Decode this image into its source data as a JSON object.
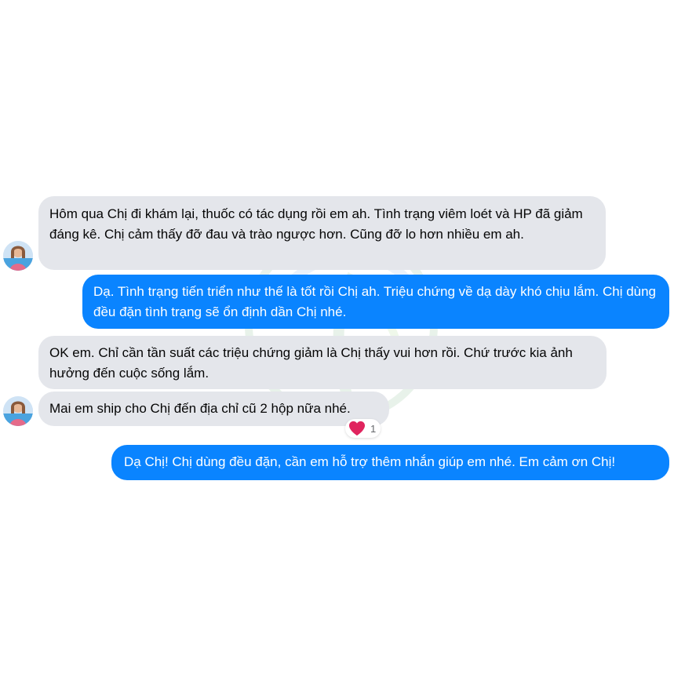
{
  "messages": [
    {
      "id": "m1",
      "direction": "incoming",
      "text": "Hôm qua Chị đi khám lại, thuốc có tác dụng rồi em ah. Tình trạng viêm loét và HP đã giảm đáng kê. Chị cảm thấy đỡ đau và trào ngược hơn. Cũng đỡ lo hơn nhiều em ah."
    },
    {
      "id": "m2",
      "direction": "outgoing",
      "text": "Dạ. Tình trạng tiến triển như thế là tốt rồi Chị ah. Triệu chứng về dạ dày khó chịu lắm. Chị dùng đều đặn tình trạng sẽ ổn định dần Chị nhé."
    },
    {
      "id": "m3",
      "direction": "incoming",
      "text": "OK em. Chỉ cần tần suất các triệu chứng giảm là Chị thấy vui hơn rồi. Chứ trước kia ảnh hưởng đến cuộc sống lắm."
    },
    {
      "id": "m4",
      "direction": "incoming",
      "text": "Mai em ship cho Chị đến địa chỉ cũ 2 hộp nữa nhé.",
      "reaction": {
        "icon": "heart-icon",
        "count": "1"
      }
    },
    {
      "id": "m5",
      "direction": "outgoing",
      "text": "Dạ Chị! Chị dùng đều đặn, cần em hỗ trợ thêm nhắn giúp em nhé. Em cảm ơn Chị!"
    }
  ],
  "colors": {
    "incoming_bubble": "#e4e6eb",
    "outgoing_bubble": "#0a84ff",
    "reaction_heart": "#e0245e"
  }
}
